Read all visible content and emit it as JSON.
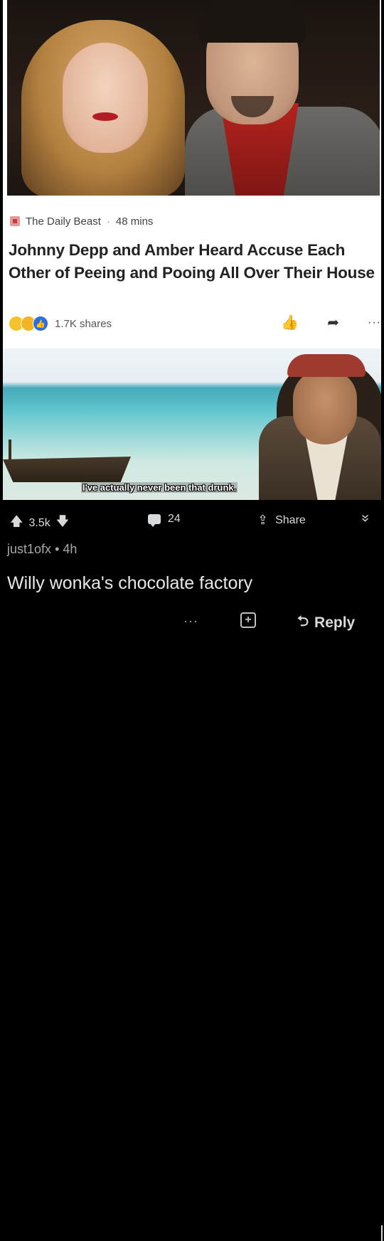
{
  "article": {
    "source": "The Daily Beast",
    "separator": "·",
    "time_ago": "48 mins",
    "headline": "Johnny Depp and Amber Heard Accuse Each Other of Peeing and Pooing All Over Their House",
    "shares": "1.7K shares",
    "more_label": "···"
  },
  "meme": {
    "caption": "I've actually never been that drunk."
  },
  "post_actions": {
    "upvotes": "3.5k",
    "comment_count": "24",
    "share_label": "Share",
    "collapse_label": "»"
  },
  "comment": {
    "username": "just1ofx",
    "meta_separator": "•",
    "age": "4h",
    "text": "Willy wonka's chocolate factory",
    "more_label": "···",
    "reply_label": "Reply"
  },
  "icons": {
    "upvote": "arrow-up-icon",
    "downvote": "arrow-down-icon",
    "comment": "comment-icon",
    "share": "share-icon",
    "award": "award-icon",
    "reply": "reply-icon",
    "like": "thumbs-up-icon",
    "article_share": "forward-arrow-icon"
  },
  "colors": {
    "background": "#000000",
    "text_light": "#d7dadc",
    "meta_gray": "#a7a9ab"
  }
}
